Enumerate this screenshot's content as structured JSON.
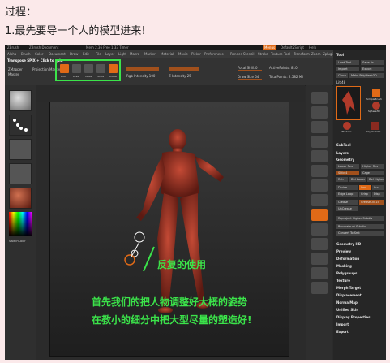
{
  "heading": "过程：",
  "step": "1.最先要导一个人的模型进来!",
  "app": {
    "title_bar": [
      "ZBrush",
      "ZBrush Document",
      "Mem 2.36 Free 1.33 Timer"
    ],
    "script_label": "DefaultZScript",
    "menu": [
      "Alpha",
      "Brush",
      "Color",
      "Document",
      "Draw",
      "Edit",
      "File",
      "Layer",
      "Light",
      "Macro",
      "Marker",
      "Material",
      "Movie",
      "Picker",
      "Preferences",
      "Render",
      "Stencil",
      "Stroke",
      "Texture",
      "Tool",
      "Transform",
      "Zoom",
      "Zplugin",
      "Zscript"
    ],
    "tooltip": "Transpose SPIX + Click to spin",
    "side_label_1": "ZMapper",
    "side_label_2": "Master",
    "proj_label": "Projection Master",
    "tool_buttons": [
      "Edit",
      "Draw",
      "Move",
      "Scale",
      "Rotate"
    ],
    "focal_label": "Focal Shift 0",
    "draw_size_label": "Draw Size 64",
    "active_points": "ActivePoints: 810",
    "total_points": "TotalPoints: 2.582 Mil",
    "rgb_label": "Rgb Intensity 100",
    "z_label": "Z Intensity 25",
    "switch_color": "SwitchColor"
  },
  "right_panel": {
    "title": "Tool",
    "buttons": [
      "Load Tool",
      "Save As",
      "Import",
      "Export",
      "Clone",
      "Make PolyMesh3D"
    ],
    "lit_label": "Lit 48",
    "tool_names": [
      "SimpleBrush",
      "Sphere3D",
      "ZSphere",
      "PolyMesh3D"
    ],
    "subtool": "SubTool",
    "layers": "Layers",
    "geometry": "Geometry",
    "geo_buttons": [
      "Lower Res",
      "Higher Res",
      "SDiv 4",
      "Cage",
      "Rstr",
      "Del Lower",
      "Del Higher",
      "Divide",
      "Smt",
      "Suv",
      "Edge Loop",
      "Crisp",
      "Disp"
    ],
    "crease": "Crease",
    "crease_lvl": "CreaseLvl 15",
    "uncrease": "UnCrease",
    "reproject": "Reproject Higher Subdiv",
    "reconstruct": "Reconstruct Subdiv",
    "convert_smt": "Convert To Smt",
    "sections": [
      "Geometry HD",
      "Preview",
      "Deformation",
      "Masking",
      "Polygroups",
      "Texture",
      "Morph Target",
      "Displacement",
      "NormalMap",
      "Unified Skin",
      "Display Properties",
      "Import",
      "Export"
    ]
  },
  "annotations": {
    "mirror_use": "反复的使用",
    "line1": "首先我们的把人物调整好大概的姿势",
    "line2": "在教小的细分中把大型尽量的塑造好!"
  },
  "colors": {
    "highlight": "#3be34a",
    "model": "#b13a2a",
    "accent": "#e06a17"
  }
}
